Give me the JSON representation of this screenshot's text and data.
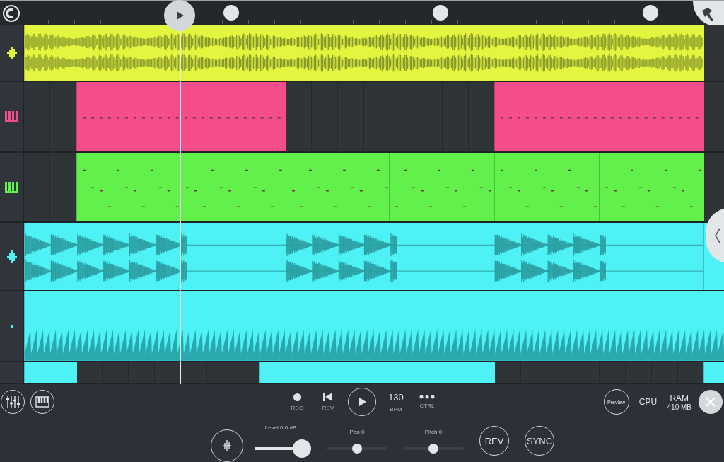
{
  "tracks": [
    {
      "kind": "audio",
      "color": "#e4f53f"
    },
    {
      "kind": "pattern",
      "color": "#f54d8c"
    },
    {
      "kind": "pattern",
      "color": "#62f04a"
    },
    {
      "kind": "audio",
      "color": "#4ef2f5"
    },
    {
      "kind": "automation",
      "color": "#4ef2f5"
    },
    {
      "kind": "automation",
      "color": "#4ef2f5"
    }
  ],
  "transport": [
    {
      "kind": "record",
      "label": "REC"
    },
    {
      "kind": "rewind",
      "label": "REV"
    },
    {
      "kind": "play"
    },
    {
      "kind": "tempo",
      "value": "130",
      "label": "BPM"
    },
    {
      "kind": "more",
      "label": "CTRL"
    }
  ],
  "status": {
    "preview": "Preview",
    "cpu": "CPU",
    "ram": "RAM",
    "ram_value": "410 MB"
  },
  "mixer": {
    "sliders": [
      {
        "label": "Level 0.0 dB",
        "level": 0.9
      },
      {
        "label": "Pan 0",
        "level": 0.5
      },
      {
        "label": "Pitch 0",
        "level": 0.5
      }
    ],
    "buttons": [
      "REV",
      "SYNC"
    ]
  }
}
